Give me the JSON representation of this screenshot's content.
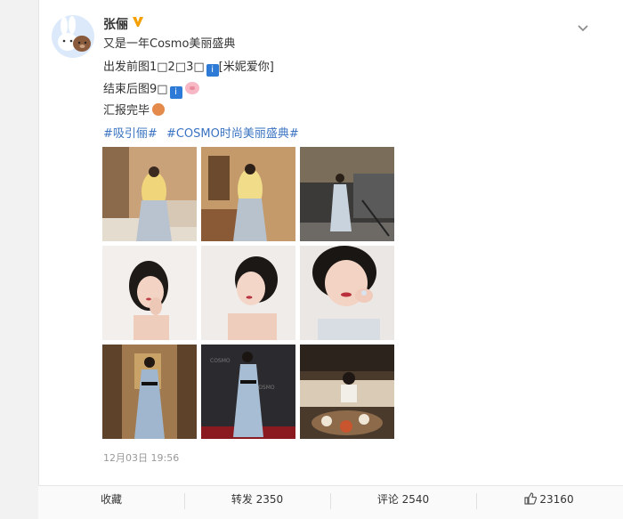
{
  "post": {
    "username": "张俪",
    "verified_icon": "verified-v-icon",
    "lines": [
      {
        "text": "又是一年Cosmo美丽盛典"
      },
      {
        "text": "出发前图1□2□3□",
        "suffix": "[米妮爱你]"
      },
      {
        "text": "结束后图9□"
      },
      {
        "text": "汇报完毕"
      }
    ],
    "hashtags": [
      "#吸引俪#",
      "#COSMO时尚美丽盛典#"
    ],
    "timestamp": "12月03日 19:56",
    "photos": [
      "photo-hotel-room-yellow-coat-1",
      "photo-hotel-room-yellow-coat-2",
      "photo-lobby-red-carpet",
      "photo-portrait-hand-chin",
      "photo-portrait-eyes-closed",
      "photo-portrait-closeup",
      "photo-hallway-full-length",
      "photo-red-carpet-backdrop",
      "photo-dinner-table"
    ]
  },
  "actions": {
    "collect": "收藏",
    "repost": "转发 2350",
    "comment": "评论 2540",
    "like": "23160"
  },
  "colors": {
    "hashtag": "#3a73c2",
    "verified": "#f5a000"
  }
}
